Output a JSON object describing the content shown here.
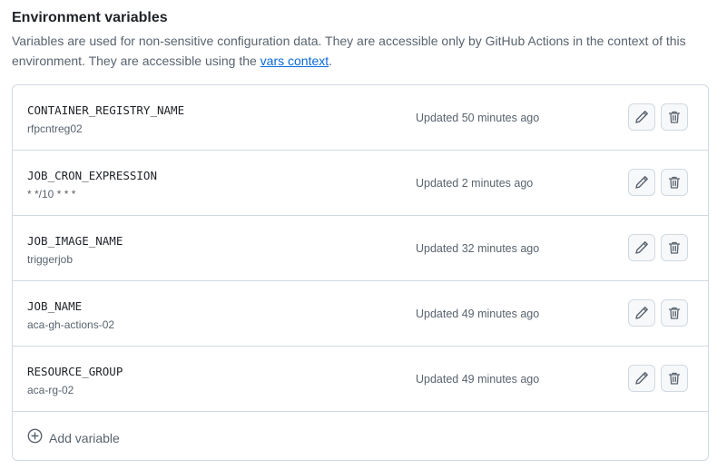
{
  "section": {
    "title": "Environment variables",
    "description_before": "Variables are used for non-sensitive configuration data. They are accessible only by GitHub Actions in the context of this environment. They are accessible using the ",
    "link_text": "vars context",
    "description_after": "."
  },
  "variables": [
    {
      "name": "CONTAINER_REGISTRY_NAME",
      "value": "rfpcntreg02",
      "updated": "Updated 50 minutes ago"
    },
    {
      "name": "JOB_CRON_EXPRESSION",
      "value": "* */10 * * *",
      "updated": "Updated 2 minutes ago"
    },
    {
      "name": "JOB_IMAGE_NAME",
      "value": "triggerjob",
      "updated": "Updated 32 minutes ago"
    },
    {
      "name": "JOB_NAME",
      "value": "aca-gh-actions-02",
      "updated": "Updated 49 minutes ago"
    },
    {
      "name": "RESOURCE_GROUP",
      "value": "aca-rg-02",
      "updated": "Updated 49 minutes ago"
    }
  ],
  "add_variable": {
    "label": "Add variable"
  },
  "icons": {
    "edit": "pencil-icon",
    "delete": "trash-icon",
    "add": "plus-circle-icon"
  },
  "colors": {
    "link": "#0969da",
    "muted_text": "#59636e",
    "border": "#d1d9e0",
    "button_bg": "#f6f8fa"
  }
}
